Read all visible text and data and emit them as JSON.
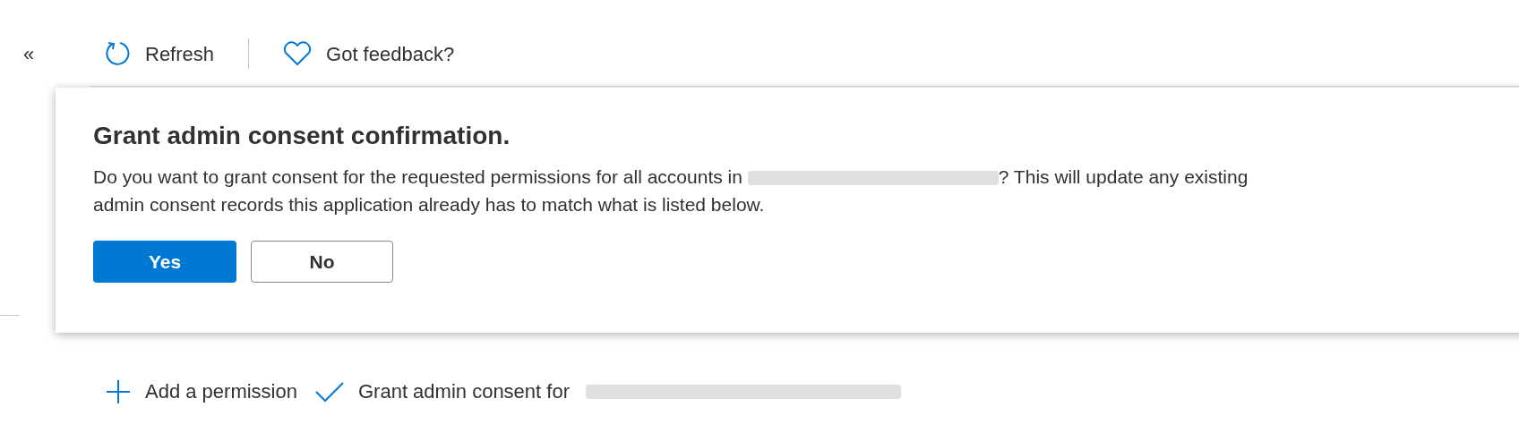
{
  "collapse": {
    "label": "«"
  },
  "toolbar": [
    {
      "kind": "refresh",
      "label": "Refresh"
    },
    {
      "kind": "feedback",
      "label": "Got feedback?"
    }
  ],
  "dialog": {
    "title": "Grant admin consent confirmation.",
    "message_before": "Do you want to grant consent for the requested permissions for all accounts in ",
    "message_after": "? This will update any existing admin consent records this application already has to match what is listed below.",
    "buttons": [
      {
        "label": "Yes",
        "primary": true
      },
      {
        "label": "No",
        "primary": false
      }
    ]
  },
  "actions": [
    {
      "kind": "add",
      "label": "Add a permission"
    },
    {
      "kind": "grant",
      "label": "Grant admin consent for"
    }
  ]
}
